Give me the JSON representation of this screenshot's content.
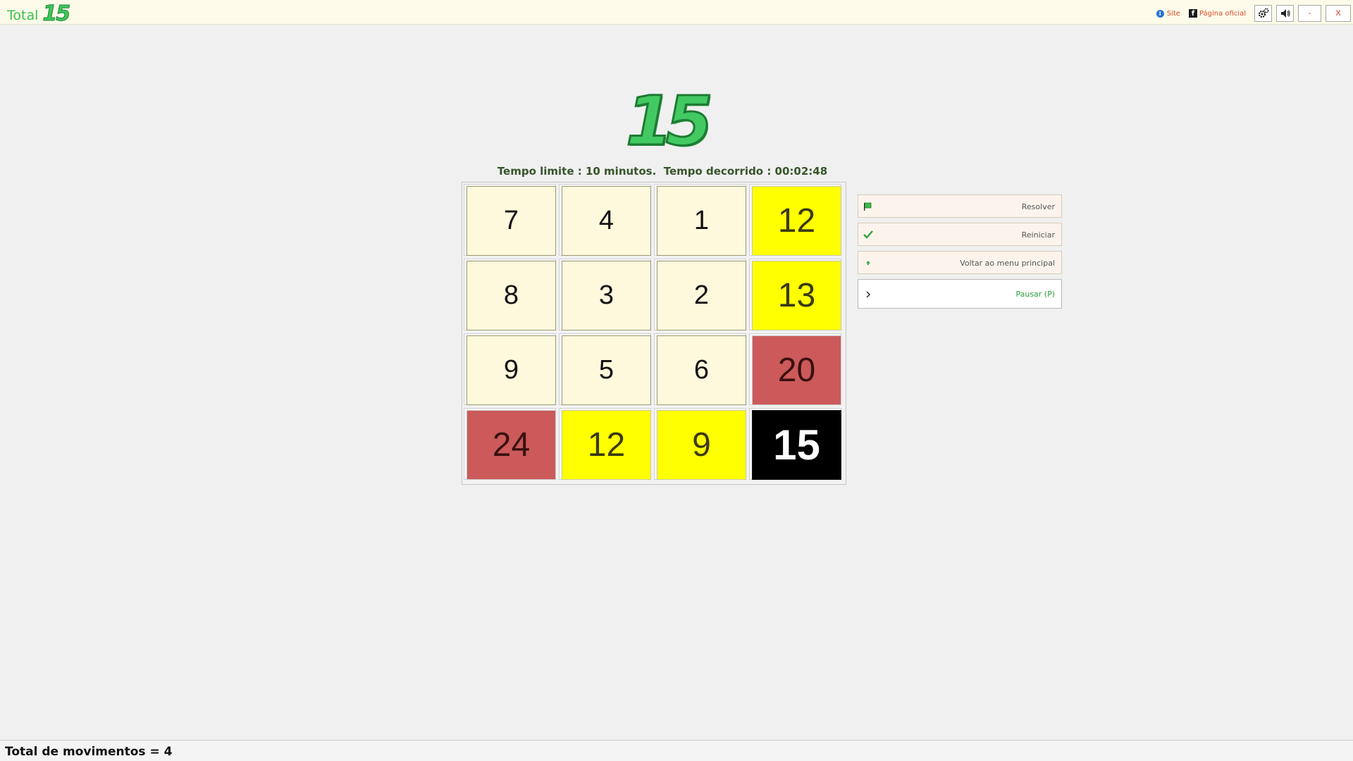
{
  "titlebar": {
    "app_word": "Total",
    "app_logo": "15",
    "links": {
      "site": "Site",
      "official_page": "Página oficial"
    },
    "buttons": {
      "settings_icon": "gear-icon",
      "sound_icon": "speaker-icon",
      "minimize": "-",
      "close": "X"
    },
    "colors": {
      "accent": "#3cbf4c",
      "link": "#d94a2a"
    }
  },
  "game": {
    "logo": "15",
    "timer_text": "Tempo limite : 10 minutos.  Tempo decorrido : 00:02:48",
    "board": {
      "rows": [
        [
          {
            "value": "7",
            "type": "plain"
          },
          {
            "value": "4",
            "type": "plain"
          },
          {
            "value": "1",
            "type": "plain"
          },
          {
            "value": "12",
            "type": "yellow"
          }
        ],
        [
          {
            "value": "8",
            "type": "plain"
          },
          {
            "value": "3",
            "type": "plain"
          },
          {
            "value": "2",
            "type": "plain"
          },
          {
            "value": "13",
            "type": "yellow"
          }
        ],
        [
          {
            "value": "9",
            "type": "plain"
          },
          {
            "value": "5",
            "type": "plain"
          },
          {
            "value": "6",
            "type": "plain"
          },
          {
            "value": "20",
            "type": "red"
          }
        ],
        [
          {
            "value": "24",
            "type": "red"
          },
          {
            "value": "12",
            "type": "yellow"
          },
          {
            "value": "9",
            "type": "yellow"
          },
          {
            "value": "15",
            "type": "black"
          }
        ]
      ],
      "colors": {
        "plain": "#fef8dd",
        "yellow": "#ffff00",
        "red": "#cc5a5a",
        "black": "#000000"
      }
    }
  },
  "side_buttons": {
    "resolver": {
      "label": "Resolver",
      "icon": "flag-icon"
    },
    "reiniciar": {
      "label": "Reiniciar",
      "icon": "checkmark-icon"
    },
    "menu": {
      "label": "Voltar ao menu principal",
      "icon": "arrow-up-icon"
    },
    "pausar": {
      "label": "Pausar (P)",
      "icon": "chevron-right-icon"
    }
  },
  "status": {
    "moves_text": "Total de movimentos = 4"
  }
}
